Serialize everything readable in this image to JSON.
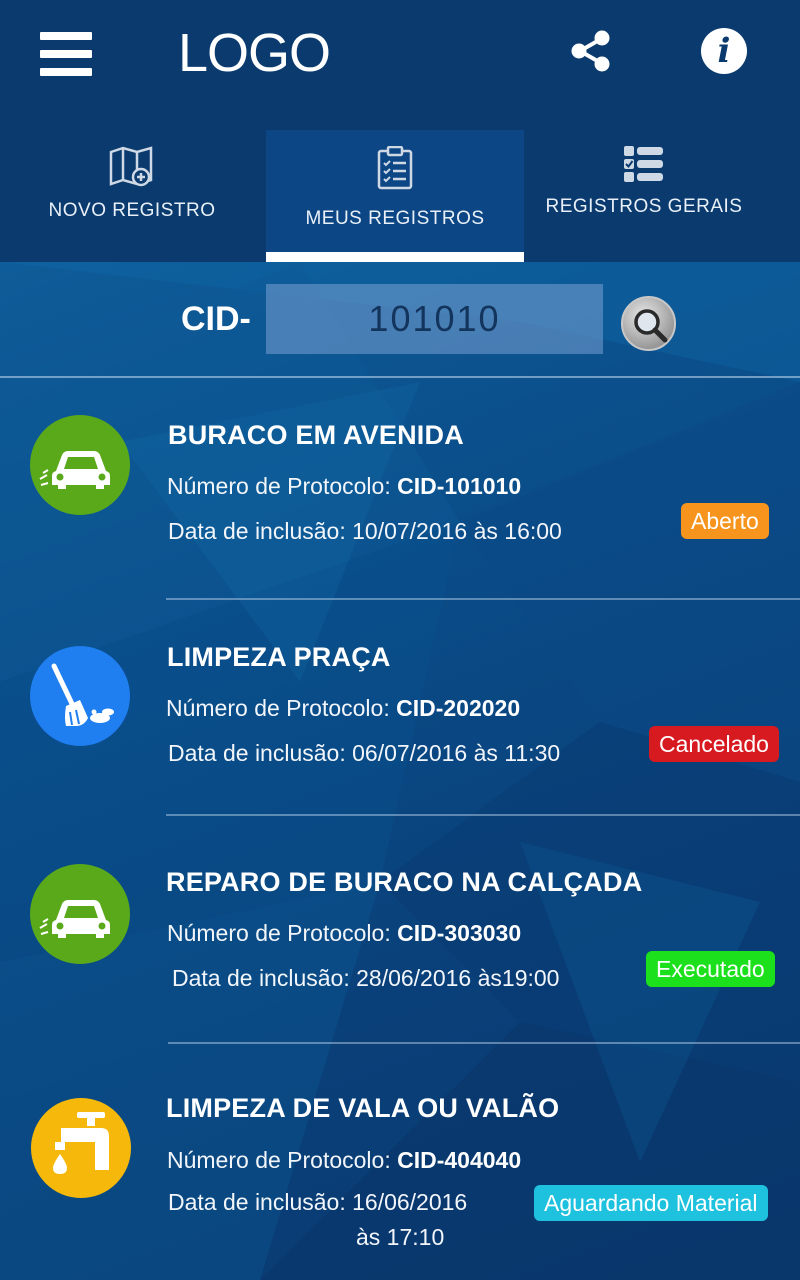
{
  "header": {
    "logo": "LOGO",
    "menu_icon": "hamburger-menu-icon",
    "share_icon": "share-icon",
    "info_icon": "info-icon",
    "info_glyph": "i"
  },
  "tabs": [
    {
      "label": "NOVO REGISTRO",
      "icon": "map-add-icon",
      "active": false
    },
    {
      "label": "MEUS REGISTROS",
      "icon": "clipboard-checklist-icon",
      "active": true
    },
    {
      "label": "REGISTROS GERAIS",
      "icon": "checklist-icon",
      "active": false
    }
  ],
  "search": {
    "prefix": "CID-",
    "value": "101010",
    "button_icon": "magnifier-icon"
  },
  "records": [
    {
      "title": "BURACO EM AVENIDA",
      "protocol_label": "Número de Protocolo: ",
      "protocol": "CID-101010",
      "date_label": "Data de inclusão: 10/07/2016 às 16:00",
      "status": "Aberto",
      "status_color": "#f7941d",
      "icon": "car-pothole-icon",
      "icon_color": "#5aa91b"
    },
    {
      "title": "LIMPEZA PRAÇA",
      "protocol_label": "Número de Protocolo: ",
      "protocol": "CID-202020",
      "date_label": "Data de inclusão: 06/07/2016 às 11:30",
      "status": "Cancelado",
      "status_color": "#d71920",
      "icon": "broom-icon",
      "icon_color": "#1f7ef0"
    },
    {
      "title": "REPARO DE BURACO NA CALÇADA",
      "protocol_label": "Número de Protocolo: ",
      "protocol": "CID-303030",
      "date_label": "Data de inclusão: 28/06/2016 às19:00",
      "status": "Executado",
      "status_color": "#1de01d",
      "icon": "car-pothole-icon",
      "icon_color": "#5aa91b"
    },
    {
      "title": "LIMPEZA DE VALA OU VALÃO",
      "protocol_label": "Número de Protocolo: ",
      "protocol": "CID-404040",
      "date_label": "Data de inclusão: 16/06/2016",
      "date_label_2": "às 17:10",
      "status": "Aguardando Material",
      "status_color": "#1ec1de",
      "icon": "faucet-drop-icon",
      "icon_color": "#f6b90b"
    }
  ]
}
